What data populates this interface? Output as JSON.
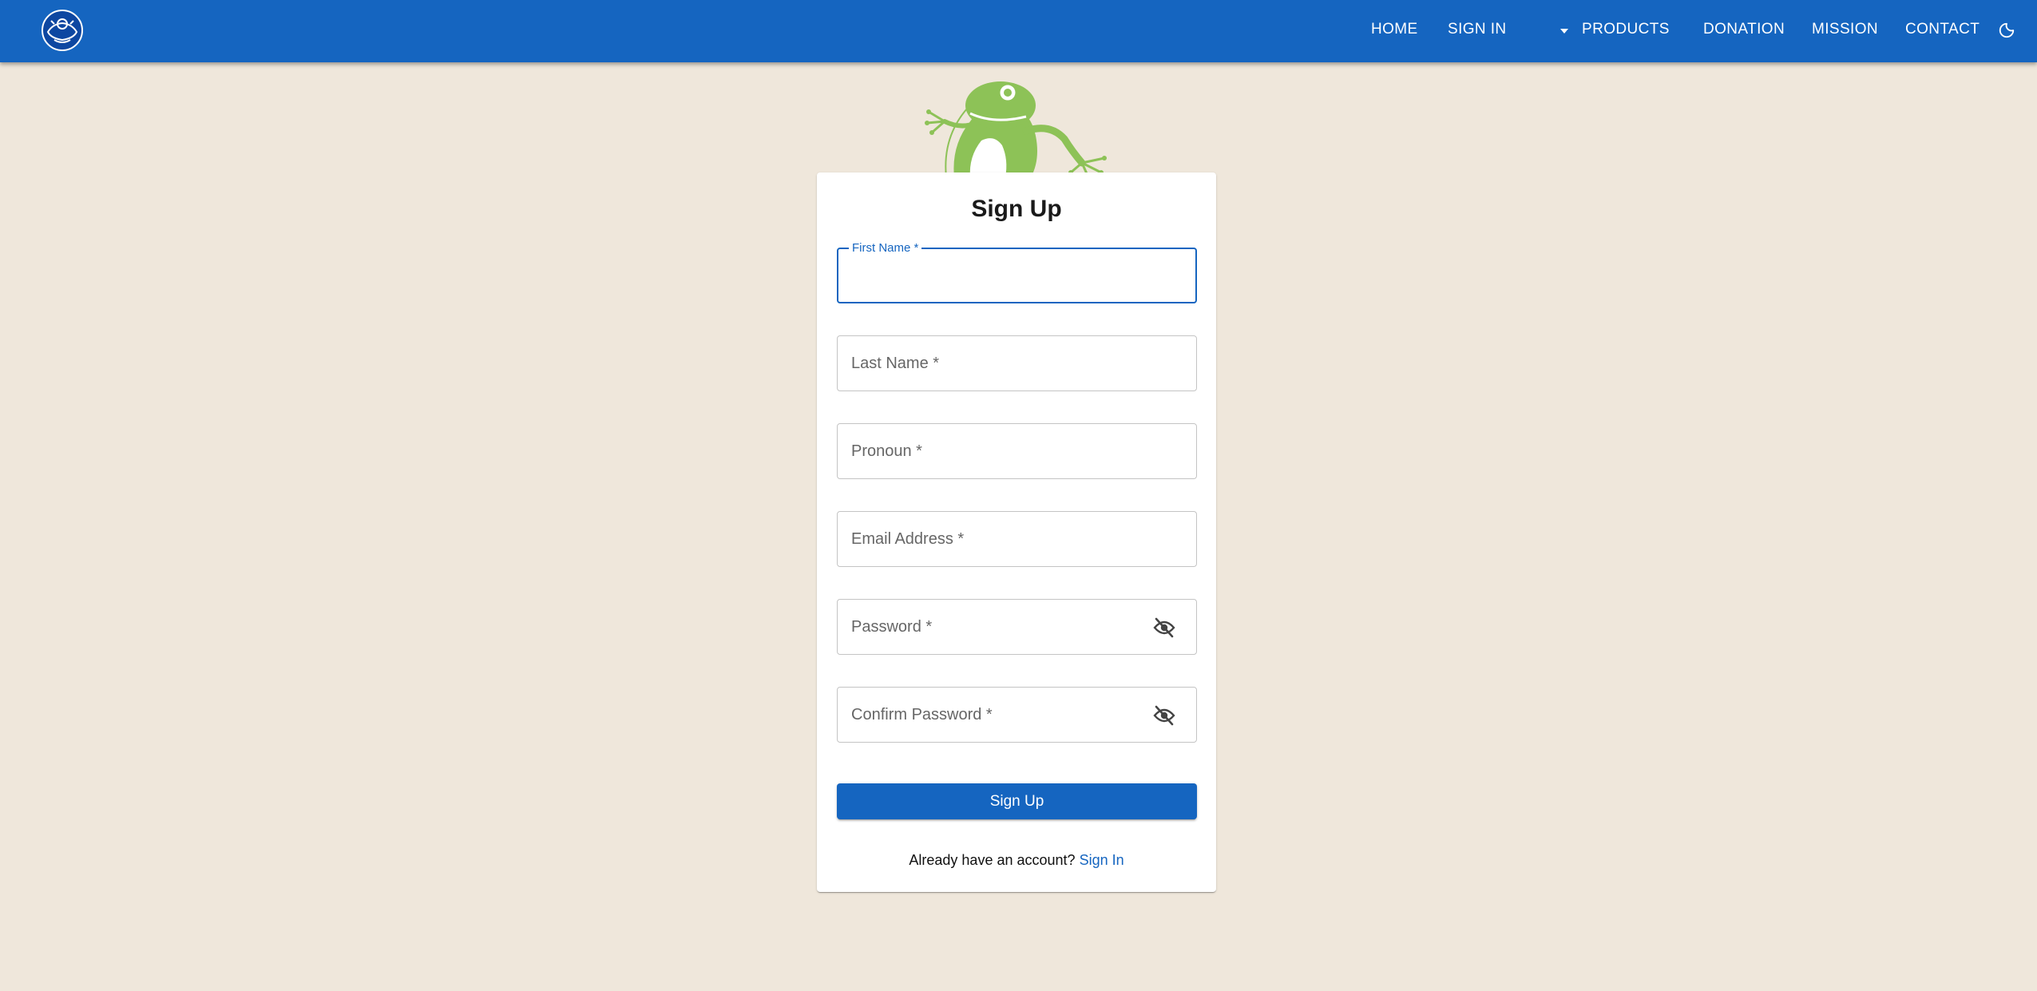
{
  "nav": {
    "home": "HOME",
    "sign_in": "SIGN IN",
    "products": "PRODUCTS",
    "donation": "DONATION",
    "mission": "MISSION",
    "contact": "CONTACT"
  },
  "form": {
    "title": "Sign Up",
    "fields": {
      "first_name": {
        "label": "First Name *",
        "value": ""
      },
      "last_name": {
        "label": "Last Name *",
        "value": ""
      },
      "pronoun": {
        "label": "Pronoun *",
        "value": ""
      },
      "email": {
        "label": "Email Address *",
        "value": ""
      },
      "password": {
        "label": "Password *",
        "value": ""
      },
      "confirm_password": {
        "label": "Confirm Password *",
        "value": ""
      }
    },
    "submit_label": "Sign Up",
    "footer_text": "Already have an account?",
    "footer_link": "Sign In"
  },
  "icons": {
    "logo": "frog-emblem-logo",
    "theme": "moon-icon",
    "password_toggle": "eye-off-icon",
    "dropdown": "caret-down-icon"
  },
  "colors": {
    "brand": "#1565c0",
    "background": "#efe7db",
    "frog": "#8dc257"
  }
}
